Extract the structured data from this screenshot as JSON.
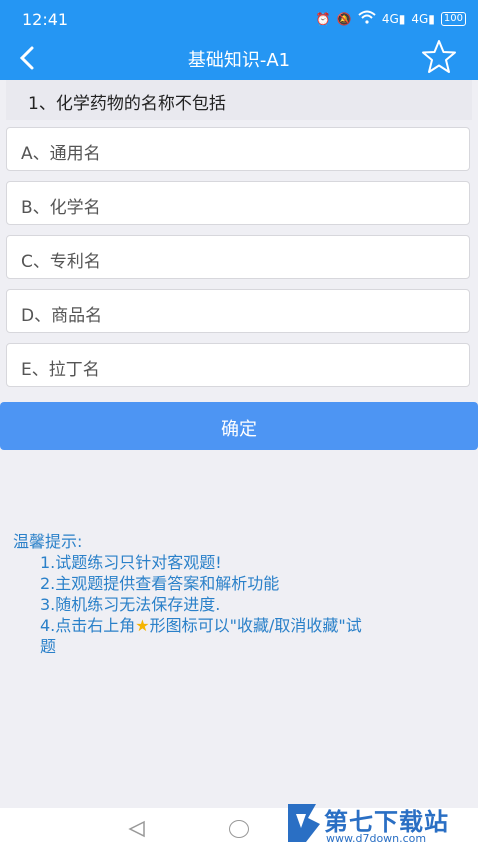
{
  "status_bar": {
    "time": "12:41",
    "network_1": "4G",
    "network_2": "4G",
    "battery": "100"
  },
  "header": {
    "title": "基础知识-A1"
  },
  "question": {
    "text": "1、化学药物的名称不包括",
    "options": [
      "A、通用名",
      "B、化学名",
      "C、专利名",
      "D、商品名",
      "E、拉丁名"
    ]
  },
  "confirm_label": "确定",
  "tips": {
    "heading": "温馨提示:",
    "items": [
      "1.试题练习只针对客观题!",
      "2.主观题提供查看答案和解析功能",
      "3.随机练习无法保存进度.",
      "4.点击右上角",
      "形图标可以\"收藏/取消收藏\"试",
      "题"
    ]
  },
  "watermark": {
    "name": "第七下载站",
    "url": "www.d7down.com"
  },
  "colors": {
    "header": "#2596f3",
    "confirm": "#4d95f3",
    "tips": "#2a80c9"
  }
}
